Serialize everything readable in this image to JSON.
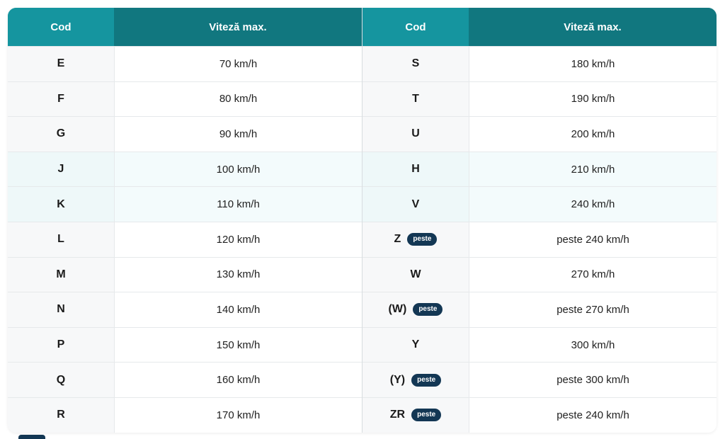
{
  "headers": {
    "left_code": "Cod",
    "left_speed": "Viteză max.",
    "right_code": "Cod",
    "right_speed": "Viteză max."
  },
  "colors": {
    "header_code": "#15959f",
    "header_speed": "#11777f",
    "badge": "#133754"
  },
  "left_rows": [
    {
      "code": "E",
      "speed": "70 km/h"
    },
    {
      "code": "F",
      "speed": "80 km/h"
    },
    {
      "code": "G",
      "speed": "90 km/h"
    },
    {
      "code": "J",
      "speed": "100 km/h"
    },
    {
      "code": "K",
      "speed": "110 km/h"
    },
    {
      "code": "L",
      "speed": "120 km/h"
    },
    {
      "code": "M",
      "speed": "130 km/h"
    },
    {
      "code": "N",
      "speed": "140 km/h"
    },
    {
      "code": "P",
      "speed": "150 km/h"
    },
    {
      "code": "Q",
      "speed": "160 km/h"
    },
    {
      "code": "R",
      "speed": "170 km/h"
    }
  ],
  "right_rows": [
    {
      "code": "S",
      "speed": "180 km/h",
      "badge": ""
    },
    {
      "code": "T",
      "speed": "190 km/h",
      "badge": ""
    },
    {
      "code": "U",
      "speed": "200 km/h",
      "badge": ""
    },
    {
      "code": "H",
      "speed": "210 km/h",
      "badge": ""
    },
    {
      "code": "V",
      "speed": "240 km/h",
      "badge": ""
    },
    {
      "code": "Z",
      "speed": "peste 240 km/h",
      "badge": "peste"
    },
    {
      "code": "W",
      "speed": "270 km/h",
      "badge": ""
    },
    {
      "code": "(W)",
      "speed": "peste 270 km/h",
      "badge": "peste"
    },
    {
      "code": "Y",
      "speed": "300 km/h",
      "badge": ""
    },
    {
      "code": "(Y)",
      "speed": "peste 300 km/h",
      "badge": "peste"
    },
    {
      "code": "ZR",
      "speed": "peste 240 km/h",
      "badge": "peste"
    }
  ]
}
